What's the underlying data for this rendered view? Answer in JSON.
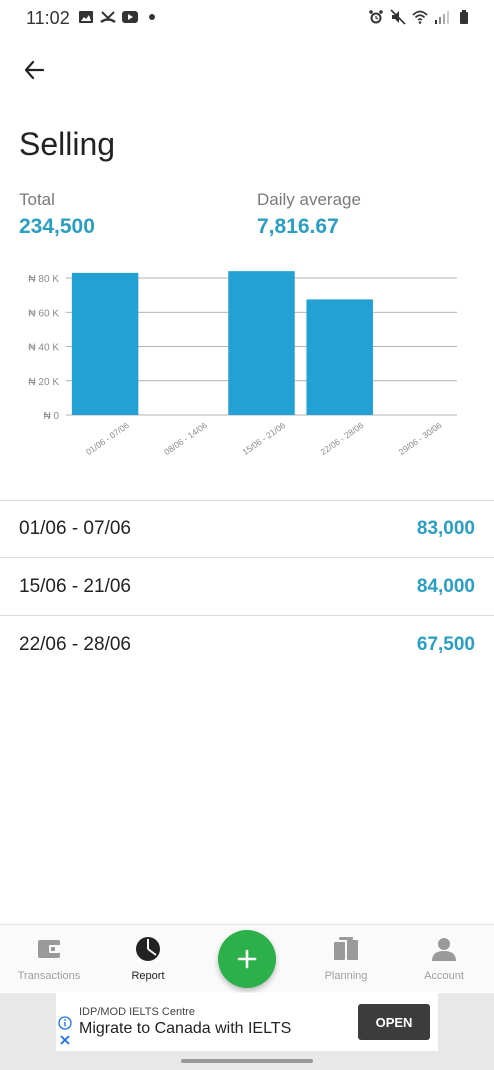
{
  "status_bar": {
    "time": "11:02"
  },
  "header": {
    "title": "Selling"
  },
  "summary": {
    "total_label": "Total",
    "total_value": "234,500",
    "average_label": "Daily average",
    "average_value": "7,816.67"
  },
  "chart_data": {
    "type": "bar",
    "categories": [
      "01/06 - 07/06",
      "08/06 - 14/06",
      "15/06 - 21/06",
      "22/06 - 28/06",
      "29/06 - 30/06"
    ],
    "values": [
      83000,
      0,
      84000,
      67500,
      0
    ],
    "yticks": [
      "₦ 0",
      "₦ 20 K",
      "₦ 40 K",
      "₦ 60 K",
      "₦ 80 K"
    ],
    "ytick_values": [
      0,
      20000,
      40000,
      60000,
      80000
    ],
    "ylim": [
      0,
      80000
    ],
    "bar_color": "#23a0d4",
    "grid": true
  },
  "rows": [
    {
      "label": "01/06 - 07/06",
      "value": "83,000"
    },
    {
      "label": "15/06 - 21/06",
      "value": "84,000"
    },
    {
      "label": "22/06 - 28/06",
      "value": "67,500"
    }
  ],
  "nav": {
    "items": [
      {
        "label": "Transactions",
        "icon": "wallet-icon"
      },
      {
        "label": "Report",
        "icon": "pie-chart-icon"
      },
      {
        "label": "Planning",
        "icon": "planning-icon"
      },
      {
        "label": "Account",
        "icon": "account-icon"
      }
    ],
    "fab_icon": "plus-icon",
    "active_color": "#222222",
    "fab_color": "#2bb04a"
  },
  "ad": {
    "advertiser": "IDP/MOD IELTS Centre",
    "headline": "Migrate to Canada with IELTS",
    "cta": "OPEN"
  },
  "colors": {
    "accent": "#2a9fc4"
  }
}
